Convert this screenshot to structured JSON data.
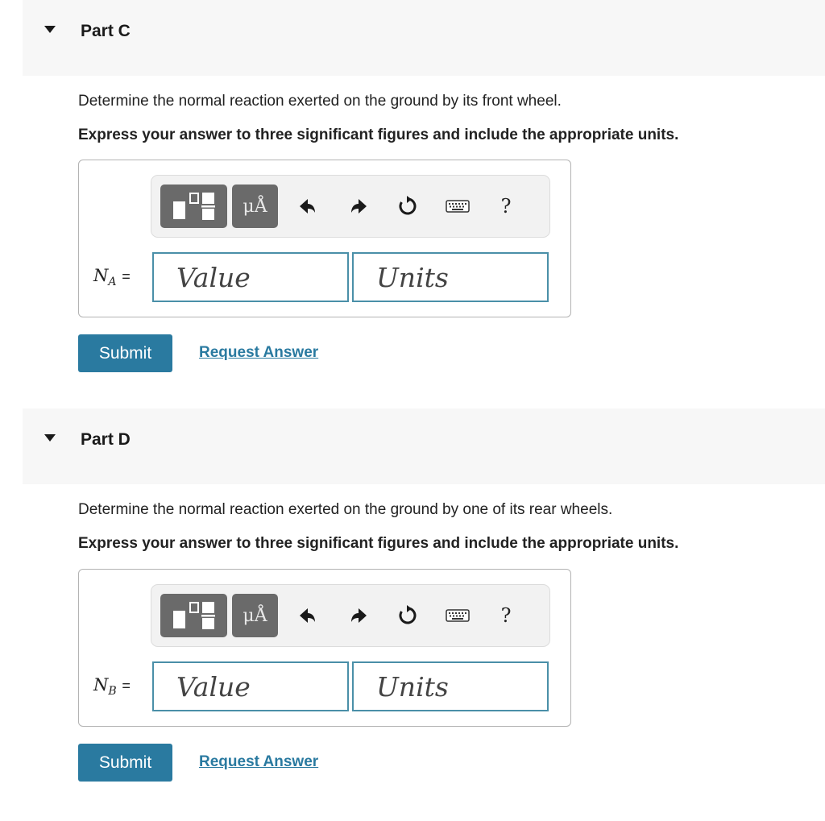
{
  "parts": [
    {
      "title": "Part C",
      "prompt": "Determine the normal reaction exerted on the ground by its front wheel.",
      "instruction": "Express your answer to three significant figures and include the appropriate units.",
      "variable": "N",
      "subscript": "A",
      "equals": "=",
      "value_placeholder": "Value",
      "units_placeholder": "Units",
      "submit_label": "Submit",
      "request_label": "Request Answer"
    },
    {
      "title": "Part D",
      "prompt": "Determine the normal reaction exerted on the ground by one of its rear wheels.",
      "instruction": "Express your answer to three significant figures and include the appropriate units.",
      "variable": "N",
      "subscript": "B",
      "equals": "=",
      "value_placeholder": "Value",
      "units_placeholder": "Units",
      "submit_label": "Submit",
      "request_label": "Request Answer"
    }
  ],
  "toolbar": {
    "units_button_label": "μÅ",
    "help_label": "?"
  },
  "colors": {
    "accent": "#2a7aa0",
    "input_border": "#4a8fa8",
    "toolbar_button": "#6a6a6a",
    "header_background": "#f7f7f7"
  }
}
